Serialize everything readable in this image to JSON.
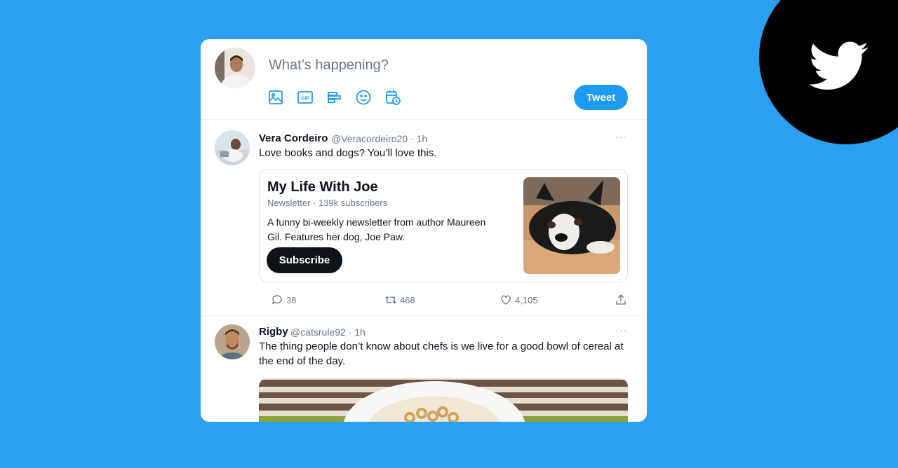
{
  "brand": {
    "logo_icon": "twitter-bird-icon",
    "background": "#2b9ff0",
    "accent": "#1d9bf0"
  },
  "compose": {
    "placeholder": "What’s happening?",
    "tools": [
      "image-icon",
      "gif-icon",
      "poll-icon",
      "emoji-icon",
      "schedule-icon"
    ],
    "tweet_label": "Tweet"
  },
  "tweets": [
    {
      "display_name": "Vera Cordeiro",
      "handle": "@Veracordeiro20",
      "time": "· 1h",
      "text": "Love books and dogs? You’ll love this.",
      "card": {
        "title": "My Life With Joe",
        "subtitle": "Newsletter · 139k subscribers",
        "description": "A funny bi-weekly newsletter from author Maureen Gil. Features her dog, Joe Paw.",
        "button": "Subscribe"
      },
      "replies": "38",
      "retweets": "468",
      "likes": "4,105"
    },
    {
      "display_name": "Rigby",
      "handle": "@catsrule92",
      "time": "· 1h",
      "text": "The thing people don’t know about chefs is we live for a good bowl of cereal at the end of the day."
    }
  ],
  "more_label": "···"
}
